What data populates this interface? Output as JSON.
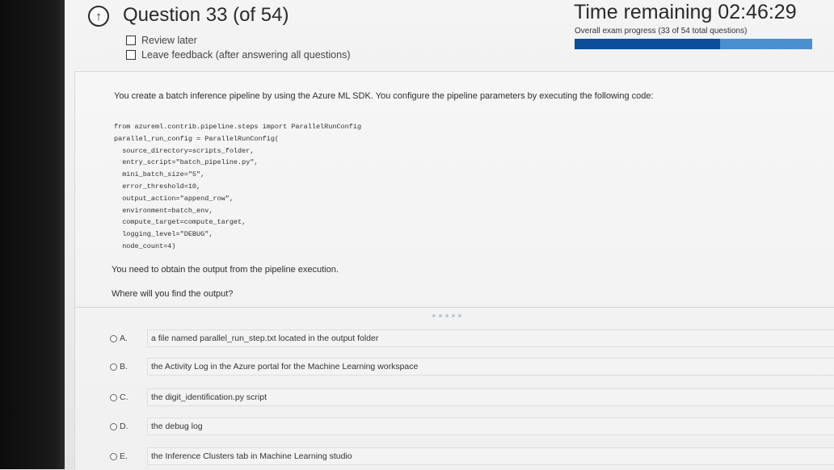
{
  "header": {
    "question_icon": "circled-up-arrow-icon",
    "question_title": "Question 33 (of 54)",
    "review_later_label": "Review later",
    "leave_feedback_label": "Leave feedback (after answering all questions)",
    "time_remaining": "Time remaining 02:46:29",
    "progress_text": "Overall exam progress (33 of 54 total questions)",
    "progress_fraction": 0.611,
    "colors": {
      "progress_fill": "#0c4e9a",
      "progress_track": "#4a8fd0"
    }
  },
  "question": {
    "stem": "You create a batch inference pipeline by using the Azure ML SDK. You configure the pipeline parameters by executing the following code:",
    "code_lines": [
      "from azureml.contrib.pipeline.steps import ParallelRunConfig",
      "parallel_run_config = ParallelRunConfig(",
      "  source_directory=scripts_folder,",
      "  entry_script=\"batch_pipeline.py\",",
      "  mini_batch_size=\"5\",",
      "  error_threshold=10,",
      "  output_action=\"append_row\",",
      "  environment=batch_env,",
      "  compute_target=compute_target,",
      "  logging_level=\"DEBUG\",",
      "  node_count=4)"
    ],
    "requirement": "You need to obtain the output from the pipeline execution.",
    "ask": "Where will you find the output?"
  },
  "answers": [
    {
      "letter": "A.",
      "text": "a file named parallel_run_step.txt located in the output folder"
    },
    {
      "letter": "B.",
      "text": "the Activity Log in the Azure portal for the Machine Learning workspace"
    },
    {
      "letter": "C.",
      "text": "the digit_identification.py script"
    },
    {
      "letter": "D.",
      "text": "the debug log"
    },
    {
      "letter": "E.",
      "text": "the Inference Clusters tab in Machine Learning studio"
    }
  ]
}
